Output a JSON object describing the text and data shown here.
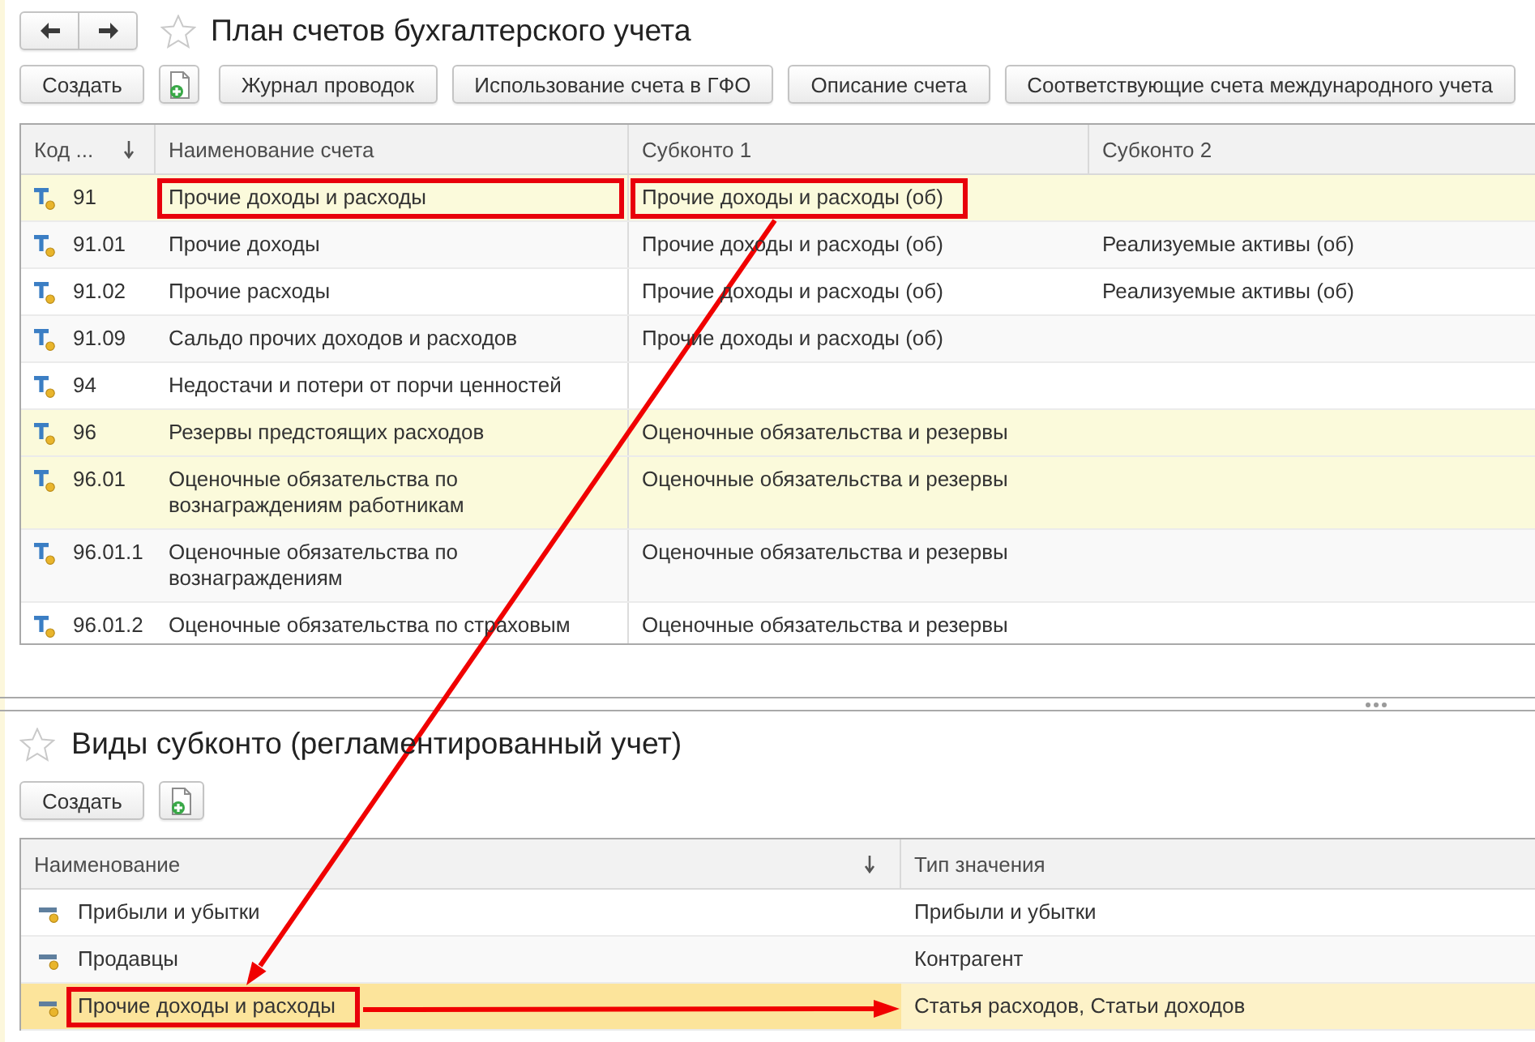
{
  "accounts_panel": {
    "title": "План счетов бухгалтерского учета",
    "favorite": false,
    "toolbar": [
      {
        "kind": "text",
        "label": "Создать"
      },
      {
        "kind": "icon"
      },
      {
        "kind": "text",
        "label": "Журнал проводок"
      },
      {
        "kind": "text",
        "label": "Использование счета в ГФО"
      },
      {
        "kind": "text",
        "label": "Описание счета"
      },
      {
        "kind": "text",
        "label": "Соответствующие счета международного учета"
      }
    ],
    "table": {
      "columns": [
        {
          "label": "Код ...",
          "sorted": true
        },
        {
          "label": "Наименование счета",
          "sorted": false
        },
        {
          "label": "Субконто 1",
          "sorted": false
        },
        {
          "label": "Субконто 2",
          "sorted": false
        }
      ],
      "rows": [
        {
          "highlighted": true,
          "cells": [
            {
              "text": "91",
              "outlined": false
            },
            {
              "text": "Прочие доходы и расходы",
              "outlined": true
            },
            {
              "text": "Прочие доходы и расходы (об)",
              "outlined": true
            },
            {
              "outlined": false
            }
          ]
        },
        {
          "highlighted": false,
          "cells": [
            {
              "text": "91.01",
              "outlined": false
            },
            {
              "text": "Прочие доходы",
              "outlined": false
            },
            {
              "text": "Прочие доходы и расходы (об)",
              "outlined": false
            },
            {
              "text": "Реализуемые активы (об)",
              "outlined": false
            }
          ]
        },
        {
          "highlighted": false,
          "cells": [
            {
              "text": "91.02",
              "outlined": false
            },
            {
              "text": "Прочие расходы",
              "outlined": false
            },
            {
              "text": "Прочие доходы и расходы (об)",
              "outlined": false
            },
            {
              "text": "Реализуемые активы (об)",
              "outlined": false
            }
          ]
        },
        {
          "highlighted": false,
          "cells": [
            {
              "text": "91.09",
              "outlined": false
            },
            {
              "text": "Сальдо прочих доходов и расходов",
              "outlined": false
            },
            {
              "text": "Прочие доходы и расходы (об)",
              "outlined": false
            },
            {
              "outlined": false
            }
          ]
        },
        {
          "highlighted": false,
          "cells": [
            {
              "text": "94",
              "outlined": false
            },
            {
              "text": "Недостачи и потери от порчи ценностей",
              "outlined": false
            },
            {
              "outlined": false
            },
            {
              "outlined": false
            }
          ]
        },
        {
          "highlighted": true,
          "cells": [
            {
              "text": "96",
              "outlined": false
            },
            {
              "text": "Резервы предстоящих расходов",
              "outlined": false
            },
            {
              "text": "Оценочные обязательства и резервы",
              "outlined": false
            },
            {
              "outlined": false
            }
          ]
        },
        {
          "highlighted": true,
          "cells": [
            {
              "text": "96.01",
              "outlined": false
            },
            {
              "text": "Оценочные обязательства по вознаграждениям работникам",
              "outlined": false
            },
            {
              "text": "Оценочные обязательства и резервы",
              "outlined": false
            },
            {
              "outlined": false
            }
          ]
        },
        {
          "highlighted": false,
          "cells": [
            {
              "text": "96.01.1",
              "outlined": false
            },
            {
              "text": "Оценочные обязательства по вознаграждениям",
              "outlined": false
            },
            {
              "text": "Оценочные обязательства и резервы",
              "outlined": false
            },
            {
              "outlined": false
            }
          ]
        },
        {
          "highlighted": false,
          "cells": [
            {
              "text": "96.01.2",
              "outlined": false
            },
            {
              "text": "Оценочные обязательства по страховым",
              "outlined": false
            },
            {
              "text": "Оценочные обязательства и резервы",
              "outlined": false
            },
            {
              "outlined": false
            }
          ]
        }
      ]
    }
  },
  "subconto_panel": {
    "title": "Виды субконто (регламентированный учет)",
    "favorite": false,
    "toolbar": [
      {
        "kind": "text",
        "label": "Создать"
      },
      {
        "kind": "icon"
      }
    ],
    "table": {
      "columns": [
        {
          "label": "Наименование",
          "sorted": true
        },
        {
          "label": "Тип значения",
          "sorted": false
        }
      ],
      "rows": [
        {
          "selected": false,
          "cells": [
            {
              "text": "Прибыли и убытки",
              "outlined": false
            },
            {
              "text": "Прибыли и убытки",
              "outlined": false
            }
          ]
        },
        {
          "selected": false,
          "cells": [
            {
              "text": "Продавцы",
              "outlined": false
            },
            {
              "text": "Контрагент",
              "outlined": false
            }
          ]
        },
        {
          "selected": true,
          "cells": [
            {
              "text": "Прочие доходы и расходы",
              "outlined": true
            },
            {
              "text": "Статья расходов, Статьи доходов",
              "outlined": false
            }
          ]
        }
      ]
    }
  }
}
